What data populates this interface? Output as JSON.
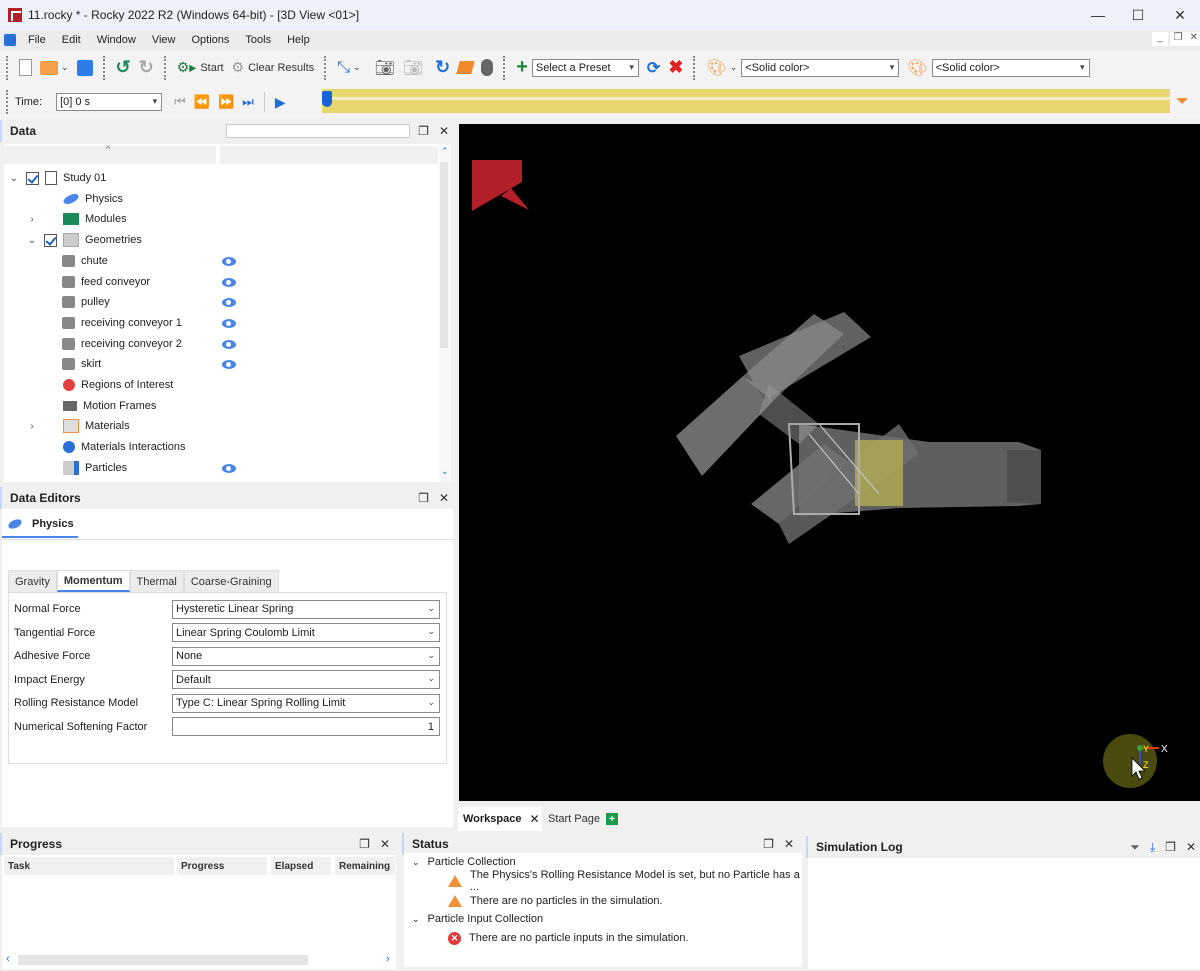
{
  "window": {
    "title": "11.rocky * - Rocky 2022 R2 (Windows 64-bit) - [3D View <01>]",
    "minimize": "—",
    "maximize": "☐",
    "close": "✕"
  },
  "menu": {
    "items": [
      "File",
      "Edit",
      "Window",
      "View",
      "Options",
      "Tools",
      "Help"
    ],
    "mdi_buttons": [
      "_",
      "❐",
      "✕"
    ]
  },
  "toolbar": {
    "start_label": "Start",
    "clear_results_label": "Clear Results",
    "preset_select": "Select a Preset",
    "color_select_1": "<Solid color>",
    "color_select_2": "<Solid color>",
    "colors": {
      "accent": "#1565d8",
      "start_green": "#1a7a3a",
      "delete_red": "#e02424"
    }
  },
  "timebar": {
    "label": "Time:",
    "value": "[0] 0 s",
    "timeline_position": 0.0,
    "timeline_color": "#e8d66f"
  },
  "data_panel": {
    "title": "Data",
    "search_value": "",
    "tree": [
      {
        "label": "Study 01",
        "level": 0,
        "expanded": true,
        "checked": true,
        "icon": "clipboard-icon"
      },
      {
        "label": "Physics",
        "level": 1,
        "icon": "physics-icon"
      },
      {
        "label": "Modules",
        "level": 1,
        "expandable": true,
        "icon": "modules-icon"
      },
      {
        "label": "Geometries",
        "level": 1,
        "expanded": true,
        "checked": true,
        "icon": "geometries-icon"
      },
      {
        "label": "chute",
        "level": 2,
        "icon": "geometry-icon",
        "visible": true
      },
      {
        "label": "feed conveyor",
        "level": 2,
        "icon": "geometry-icon",
        "visible": true
      },
      {
        "label": "pulley",
        "level": 2,
        "icon": "geometry-icon",
        "visible": true
      },
      {
        "label": "receiving conveyor 1",
        "level": 2,
        "icon": "geometry-icon",
        "visible": true
      },
      {
        "label": "receiving conveyor 2",
        "level": 2,
        "icon": "geometry-icon",
        "visible": true
      },
      {
        "label": "skirt",
        "level": 2,
        "icon": "geometry-icon",
        "visible": true
      },
      {
        "label": "Regions of Interest",
        "level": 1,
        "icon": "regions-icon"
      },
      {
        "label": "Motion Frames",
        "level": 1,
        "icon": "motion-frames-icon"
      },
      {
        "label": "Materials",
        "level": 1,
        "expandable": true,
        "icon": "materials-icon"
      },
      {
        "label": "Materials Interactions",
        "level": 1,
        "icon": "materials-interactions-icon"
      },
      {
        "label": "Particles",
        "level": 1,
        "icon": "particles-icon",
        "visible": true
      }
    ]
  },
  "data_editors": {
    "title": "Data Editors",
    "editor_tab": "Physics",
    "tabs": [
      "Gravity",
      "Momentum",
      "Thermal",
      "Coarse-Graining"
    ],
    "active_tab": "Momentum",
    "fields": [
      {
        "label": "Normal Force",
        "value": "Hysteretic Linear Spring",
        "type": "select"
      },
      {
        "label": "Tangential Force",
        "value": "Linear Spring Coulomb Limit",
        "type": "select"
      },
      {
        "label": "Adhesive Force",
        "value": "None",
        "type": "select"
      },
      {
        "label": "Impact Energy",
        "value": "Default",
        "type": "select"
      },
      {
        "label": "Rolling Resistance Model",
        "value": "Type C: Linear Spring Rolling Limit",
        "type": "select"
      },
      {
        "label": "Numerical Softening Factor",
        "value": "1",
        "type": "number"
      }
    ]
  },
  "viewport": {
    "axes": {
      "x": "X",
      "y": "Y",
      "z": "Z"
    }
  },
  "doc_tabs": {
    "tabs": [
      "Workspace",
      "Start Page"
    ],
    "active": "Workspace"
  },
  "progress_panel": {
    "title": "Progress",
    "columns": [
      "Task",
      "Progress",
      "Elapsed",
      "Remaining"
    ],
    "rows": []
  },
  "status_panel": {
    "title": "Status",
    "groups": [
      {
        "label": "Particle Collection",
        "items": [
          {
            "severity": "warning",
            "text": "The Physics's Rolling Resistance Model is set, but no Particle has a ..."
          },
          {
            "severity": "warning",
            "text": "There are no particles in the simulation."
          }
        ]
      },
      {
        "label": "Particle Input Collection",
        "items": [
          {
            "severity": "error",
            "text": "There are no particle inputs in the simulation."
          }
        ]
      }
    ]
  },
  "simulation_log": {
    "title": "Simulation Log"
  }
}
